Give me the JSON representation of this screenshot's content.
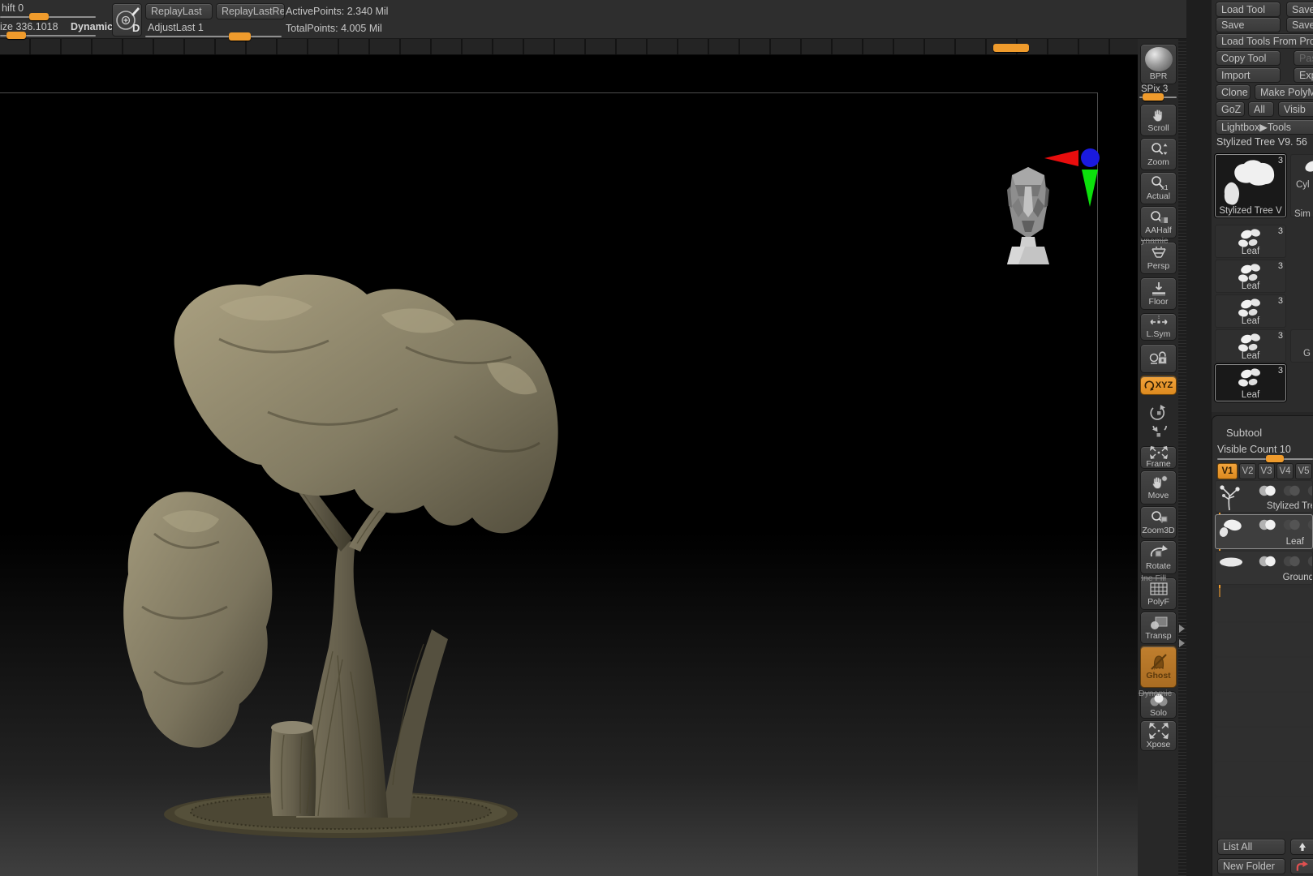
{
  "colors": {
    "accent_orange": "#ef9b2c",
    "panel_bg": "#2c2c2c",
    "canvas_black": "#000000",
    "gizmo_x_red": "#e90d0d",
    "gizmo_z_blue": "#1a1adf",
    "gizmo_y_green": "#0ce00c",
    "model_khaki": "#8a8268",
    "trunk_brown": "#6e6856"
  },
  "top_bar": {
    "shift": "hift 0",
    "size": "ize 336.1018",
    "dynamic": "Dynamic",
    "draw_letter": "D",
    "replay_last": "ReplayLast",
    "replay_last_rel": "ReplayLastRel",
    "adjust_last": "AdjustLast 1",
    "active_points": "ActivePoints: 2.340 Mil",
    "total_points": "TotalPoints: 4.005 Mil"
  },
  "canvas": {
    "model_description": "stylized tree sculpture with two foliage blobs, trunk, stump and ground disc",
    "gizmo": {
      "head": "camera-orientation-head",
      "x_axis": "red-left-triangle",
      "z_axis": "blue-circle",
      "y_axis": "green-down-triangle"
    }
  },
  "right_toolbar": {
    "ghost_texts": [
      "ynamic",
      "Ine Fill",
      "Dynamic"
    ],
    "items": [
      {
        "label": "BPR",
        "icon": "bpr-sphere-icon"
      },
      {
        "label": "SPix 3",
        "icon": "spix-slider",
        "type": "slider"
      },
      {
        "label": "Scroll",
        "icon": "pan-hand-icon"
      },
      {
        "label": "Zoom",
        "icon": "magnifier-updown-icon"
      },
      {
        "label": "Actual",
        "icon": "magnifier-x1-icon"
      },
      {
        "label": "AAHalf",
        "icon": "magnifier-half-icon"
      },
      {
        "label": "Persp",
        "icon": "perspective-grid-icon"
      },
      {
        "label": "Floor",
        "icon": "floor-arrow-icon"
      },
      {
        "label": "L.Sym",
        "icon": "symmetry-arrows-icon"
      },
      {
        "label": "",
        "icon": "camera-lock-icon"
      },
      {
        "label": "XYZ",
        "icon": "xyz-rotate-icon",
        "accent": true
      },
      {
        "label": "",
        "icon": "rotate-y-icon",
        "bare": true
      },
      {
        "label": "",
        "icon": "rotate-z-icon",
        "bare": true
      },
      {
        "label": "Frame",
        "icon": "frame-corners-icon"
      },
      {
        "label": "Move",
        "icon": "move-hand-icon"
      },
      {
        "label": "Zoom3D",
        "icon": "zoom3d-icon"
      },
      {
        "label": "Rotate",
        "icon": "rotate3d-icon"
      },
      {
        "label": "PolyF",
        "icon": "polyframe-grid-icon"
      },
      {
        "label": "Transp",
        "icon": "transparency-icon"
      },
      {
        "label": "Ghost",
        "icon": "ghost-icon",
        "active": true
      },
      {
        "label": "Solo",
        "icon": "solo-circles-icon"
      },
      {
        "label": "Xpose",
        "icon": "xpose-arrows-icon"
      }
    ]
  },
  "tool_panel": {
    "load_tool": "Load Tool",
    "save_r1": "Save",
    "save_left": "Save",
    "save_r2": "Save",
    "load_tools_from": "Load Tools From Pro",
    "copy_tool": "Copy Tool",
    "paste": "Past",
    "import": "Import",
    "export": "Expo",
    "clone": "Clone",
    "make_polymesh": "Make PolyMe",
    "goz": "GoZ",
    "all": "All",
    "visible": "Visib",
    "lightbox": "Lightbox▶Tools",
    "tool_name": "Stylized Tree V9. 56",
    "items": [
      {
        "name": "Stylized Tree V",
        "badge": "3",
        "selected": true,
        "thumb": "tree-thumb"
      },
      {
        "name": "Leaf",
        "badge": "3",
        "thumb": "leaf-thumb"
      },
      {
        "name": "Leaf",
        "badge": "3",
        "thumb": "leaf-thumb"
      },
      {
        "name": "Leaf",
        "badge": "3",
        "thumb": "leaf-thumb"
      },
      {
        "name": "Leaf",
        "badge": "3",
        "thumb": "leaf-thumb"
      },
      {
        "name": "Leaf",
        "badge": "3",
        "selected": true,
        "thumb": "leaf-thumb"
      }
    ],
    "partial_labels": {
      "col2_a": "Cyl",
      "col2_b": "Sim",
      "col2_c": "G"
    }
  },
  "subtool_panel": {
    "title": "Subtool",
    "visible_count": "Visible Count 10",
    "tabs": [
      "V1",
      "V2",
      "V3",
      "V4",
      "V5",
      "V"
    ],
    "active_tab": "V1",
    "rows": [
      {
        "name": "Stylized Tre",
        "thumb": "tree-glyph",
        "eye_on": true
      },
      {
        "name": "Leaf",
        "thumb": "leaf-glyph",
        "eye_on": true,
        "selected": true
      },
      {
        "name": "Ground",
        "thumb": "ground-glyph",
        "eye_on": true
      }
    ],
    "list_all": "List All",
    "new_folder": "New Folder",
    "up_icon": "up-arrow-icon",
    "folder_icon": "curved-arrow-icon"
  }
}
